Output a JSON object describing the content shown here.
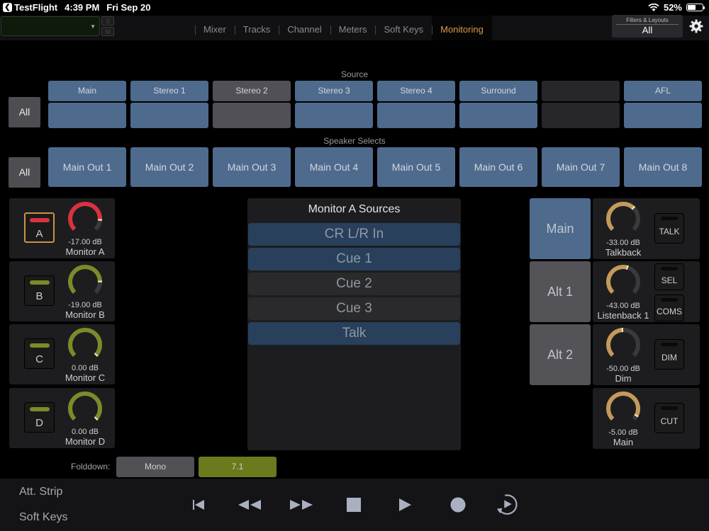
{
  "status_bar": {
    "back_app": "TestFlight",
    "time": "4:39 PM",
    "date": "Fri Sep 20",
    "battery": "52%",
    "battery_level": 0.52
  },
  "top_bar": {
    "selector_value": "",
    "solo_label": "S",
    "mute_label": "M",
    "tabs": [
      {
        "label": "Mixer",
        "active": false
      },
      {
        "label": "Tracks",
        "active": false
      },
      {
        "label": "Channel",
        "active": false
      },
      {
        "label": "Meters",
        "active": false
      },
      {
        "label": "Soft Keys",
        "active": false
      },
      {
        "label": "Monitoring",
        "active": true
      }
    ],
    "filters_title": "Filters & Layouts",
    "filters_value": "All"
  },
  "source": {
    "label": "Source",
    "all_label": "All",
    "buttons": [
      {
        "label": "Main",
        "state": "blue"
      },
      {
        "label": "Stereo 1",
        "state": "blue"
      },
      {
        "label": "Stereo 2",
        "state": "gray"
      },
      {
        "label": "Stereo 3",
        "state": "blue"
      },
      {
        "label": "Stereo 4",
        "state": "blue"
      },
      {
        "label": "Surround",
        "state": "blue"
      },
      {
        "label": "",
        "state": "dark"
      },
      {
        "label": "AFL",
        "state": "blue"
      }
    ]
  },
  "speakers": {
    "label": "Speaker Selects",
    "all_label": "All",
    "buttons": [
      "Main Out 1",
      "Main Out 2",
      "Main Out 3",
      "Main Out 4",
      "Main Out 5",
      "Main Out 6",
      "Main Out 7",
      "Main Out 8"
    ]
  },
  "monitors": [
    {
      "key": "A",
      "value": "-17.00 dB",
      "name": "Monitor A",
      "color": "#d9323f",
      "level": 0.86,
      "selected": true
    },
    {
      "key": "B",
      "value": "-19.00 dB",
      "name": "Monitor B",
      "color": "#7d8a2a",
      "level": 0.84,
      "selected": false
    },
    {
      "key": "C",
      "value": "0.00 dB",
      "name": "Monitor C",
      "color": "#7d8a2a",
      "level": 1.0,
      "selected": false
    },
    {
      "key": "D",
      "value": "0.00 dB",
      "name": "Monitor D",
      "color": "#7d8a2a",
      "level": 1.0,
      "selected": false
    }
  ],
  "monitor_sources": {
    "title": "Monitor A Sources",
    "items": [
      {
        "label": "CR L/R In",
        "on": true
      },
      {
        "label": "Cue 1",
        "on": true
      },
      {
        "label": "Cue 2",
        "on": false
      },
      {
        "label": "Cue 3",
        "on": false
      },
      {
        "label": "Talk",
        "on": true
      }
    ]
  },
  "outputs": [
    {
      "label": "Main",
      "state": "blue"
    },
    {
      "label": "Alt 1",
      "state": "gray"
    },
    {
      "label": "Alt 2",
      "state": "gray"
    }
  ],
  "controls": [
    {
      "value": "-33.00 dB",
      "name": "Talkback",
      "level": 0.67,
      "buttons": [
        "TALK"
      ]
    },
    {
      "value": "-43.00 dB",
      "name": "Listenback 1",
      "level": 0.57,
      "buttons": [
        "SEL",
        "COMS"
      ]
    },
    {
      "value": "-50.00 dB",
      "name": "Dim",
      "level": 0.5,
      "buttons": [
        "DIM"
      ]
    },
    {
      "value": "-5.00 dB",
      "name": "Main",
      "level": 0.95,
      "buttons": [
        "CUT"
      ]
    }
  ],
  "knob_color": "#c29a5a",
  "folddown": {
    "label": "Folddown:",
    "options": [
      {
        "label": "Mono",
        "color": "#505055"
      },
      {
        "label": "7.1",
        "color": "#6a7a1c"
      }
    ]
  },
  "bottom": {
    "att_strip": "Att. Strip",
    "soft_keys": "Soft Keys",
    "transport": [
      "skip-to-start",
      "rewind",
      "fast-forward",
      "stop",
      "play",
      "record",
      "loop-play"
    ]
  }
}
